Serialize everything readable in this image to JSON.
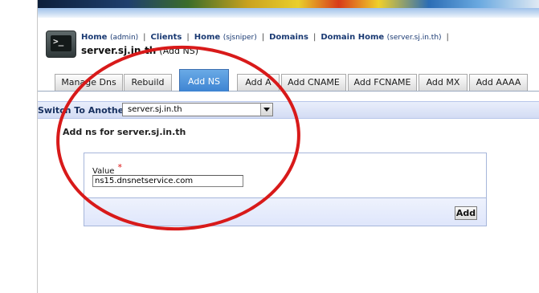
{
  "breadcrumb": {
    "items": [
      {
        "label": "Home",
        "arg": "(admin)"
      },
      {
        "label": "Clients",
        "arg": ""
      },
      {
        "label": "Home",
        "arg": "(sjsniper)"
      },
      {
        "label": "Domains",
        "arg": ""
      },
      {
        "label": "Domain Home",
        "arg": "(server.sj.in.th)"
      }
    ],
    "separator": "|"
  },
  "page": {
    "title": "server.sj.in.th",
    "subtitle": "(Add NS)"
  },
  "tabs": [
    {
      "label": "Manage Dns",
      "active": false
    },
    {
      "label": "Rebuild",
      "active": false
    },
    {
      "label": "Add NS",
      "active": true
    },
    {
      "label": "Add A",
      "active": false
    },
    {
      "label": "Add CNAME",
      "active": false
    },
    {
      "label": "Add FCNAME",
      "active": false
    },
    {
      "label": "Add MX",
      "active": false
    },
    {
      "label": "Add AAAA",
      "active": false
    }
  ],
  "switch": {
    "label": "Switch To Another",
    "selected": "server.sj.in.th"
  },
  "section": {
    "title": "Add ns for server.sj.in.th"
  },
  "form": {
    "value_label": "Value",
    "required_mark": "*",
    "value": "ns15.dnsnetservice.com",
    "submit_label": "Add"
  },
  "icons": {
    "console": "console-icon",
    "dropdown": "chevron-down-icon"
  },
  "colors": {
    "active_tab": "#3e84d2",
    "link": "#1a3a73",
    "annotation": "#d81a1a"
  }
}
